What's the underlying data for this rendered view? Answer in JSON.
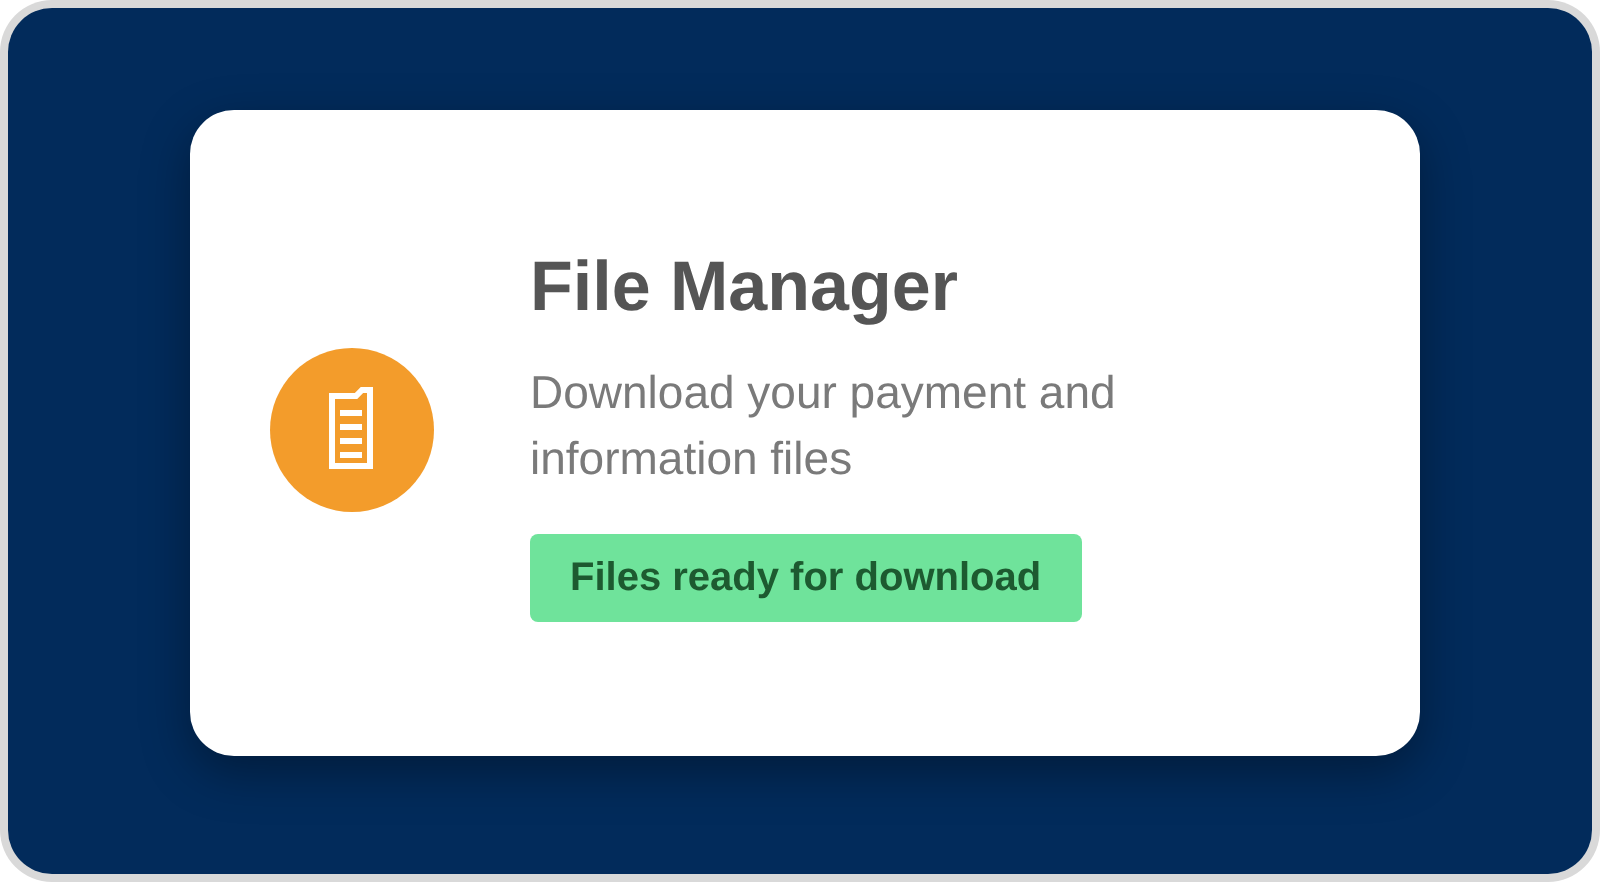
{
  "card": {
    "title": "File Manager",
    "description": "Download your payment and information files",
    "badge": "Files ready for download"
  }
}
